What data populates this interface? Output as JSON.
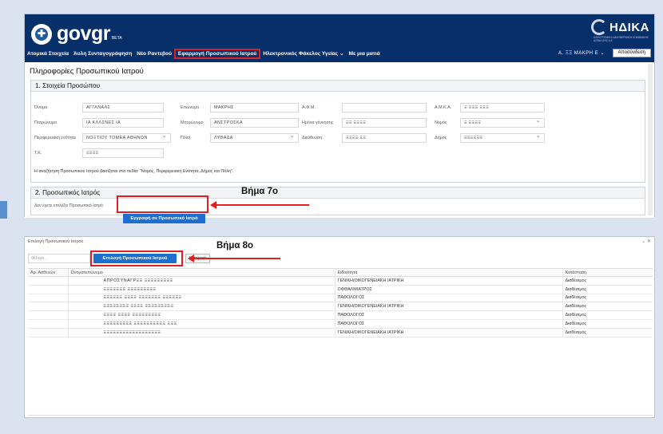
{
  "header": {
    "gov_logo_text": "gov",
    "gov_logo_suffix": "gr",
    "gov_beta": "BETA",
    "idika_text": "ΗΔΙΚΑ",
    "idika_sub": "ΗΛΕΚΤΡΟΝΙΚΗ ΔΙΑΚΥΒΕΡΝΗΣΗ ΚΟΙΝΩΝΙΚΗΣ ΑΣΦΑΛΙΣΗΣ Α.Ε."
  },
  "nav": {
    "items": [
      "Ατομικά Στοιχεία",
      "Άυλη Συνταγογράφηση",
      "Νέο Ραντεβού",
      "Εφαρμογή Προσωπικού Ιατρού",
      "Ηλεκτρονικός Φάκελος Υγείας ⌄",
      "Με μια ματιά"
    ],
    "user": "Α. ΞΞ ΜΑΚΡΗ Ε ⌄",
    "logout": "Αποσύνδεση"
  },
  "page": {
    "title": "Πληροφορίες Προσωπικού Ιατρού",
    "section1_title": "1. Στοιχεία Προσώπου",
    "section2_title": "2. Προσωπικός Ιατρός",
    "fields": {
      "onoma_label": "Όνομα",
      "onoma_value": "ΑΓΓΛΝΑΛΣ",
      "eponymo_label": "Επώνυμο",
      "eponymo_value": "ΜΑΚΡΗΣ",
      "afm_label": "Α.Φ.Μ.",
      "afm_value": "",
      "amka_label": "Α.Μ.Κ.Α.",
      "amka_value": "Ξ ΞΞΞ ΞΞΞ",
      "patronymo_label": "Πατρώνυμο",
      "patronymo_value": "ΙΑ ΚΛΛΣΝΕΣ ΙΑ",
      "mitronymo_label": "Μητρώνυμο",
      "mitronymo_value": "ΑΝΣΤΡΟΣΚΑ",
      "dob_label": "Ημ/νια γέννησης",
      "dob_value": "ΞΞ ΞΞΞΞ",
      "nomos_label": "Νομός",
      "nomos_value": "Ξ ΞΞΞΞ",
      "perif_label": "Περιφερειακή ενότητα",
      "perif_value": "ΝΟΞΤΙΟΥ ΤΟΜΕΑ ΑΘΗΝΩΝ",
      "poli_label": "Πόλη",
      "poli_value": "ΛΥΘΑΔΑ",
      "dieuthinsi_label": "Διεύθυνση",
      "dieuthinsi_value": "ΞΞΞΞ ΞΞ",
      "dimos_label": "Δήμος",
      "dimos_value": "ΞΞΞΞΞΞ",
      "tk_label": "Τ.Κ.",
      "tk_value": "ΞΞΞΞ"
    },
    "info_note": "Η αναζήτηση Προσωπικού Ιατρού βασίζεται στα πεδία: \"Νομός, Περιφερειακή Ενότητα, Δήμος και Πόλη\".",
    "no_doctor_text": "Δεν έχετε επιλέξει Προσωπικό Ιατρό",
    "register_button": "Εγγραφή σε Προσωπικό Ιατρό",
    "step7": "Βήμα 7ο"
  },
  "dialog": {
    "title": "Επιλογή Προσωπικού Ιατρού",
    "controls": "⌄  ✕",
    "filter_placeholder": "Φίλτρο...",
    "select_button": "Επιλογή Προσωπικού Ιατρού",
    "history_button": "Ιστορικό",
    "step8": "Βήμα 8ο",
    "columns": [
      "Αρ. Ασθενών",
      "Ονοματεπώνυμο",
      "Ειδικότητα",
      "Κατάσταση"
    ],
    "rows": [
      {
        "count": "",
        "name": "ΑΠΡΟΣΥΝΑΓΡΞΞ ΞΞΞΞΞΞΞΞΞ",
        "spec": "ΓΕΝΙΚΗ/ΟΙΚΟΓΕΝΕΙΑΚΗ ΙΑΤΡΙΚΗ",
        "status": "Διαθέσιμος"
      },
      {
        "count": "",
        "name": "ΞΞΞΞΞΞΞ ΞΞΞΞΞΞΞΞΞ",
        "spec": "ΟΦΘΑΛΜΙΑΤΡΟΣ",
        "status": "Διαθέσιμος"
      },
      {
        "count": "",
        "name": "ΞΞΞΞΞΞ ΞΞΞΞ ΞΞΞΞΞΞΞ ΞΞΞΞΞΞ",
        "spec": "ΠΑΘΟΛΟΓΟΣ",
        "status": "Διαθέσιμος"
      },
      {
        "count": "",
        "name": "ΞΞΞΞΞΞΞΞ ΞΞΞΞ ΞΞΞΞΞΞΞΞΞ",
        "spec": "ΓΕΝΙΚΗ/ΟΙΚΟΓΕΝΕΙΑΚΗ ΙΑΤΡΙΚΗ",
        "status": "Διαθέσιμος"
      },
      {
        "count": "",
        "name": "ΞΞΞΞ ΞΞΞΞ ΞΞΞΞΞΞΞΞΞ",
        "spec": "ΠΑΘΟΛΟΓΟΣ",
        "status": "Διαθέσιμος"
      },
      {
        "count": "",
        "name": "ΞΞΞΞΞΞΞΞΞ ΞΞΞΞΞΞΞΞΞΞ ΞΞΞ",
        "spec": "ΠΑΘΟΛΟΓΟΣ",
        "status": "Διαθέσιμος"
      },
      {
        "count": "",
        "name": "ΞΞΞΞΞΞΞΞΞΞΞΞΞΞΞΞΞΞ",
        "spec": "ΓΕΝΙΚΗ/ΟΙΚΟΓΕΝΕΙΑΚΗ ΙΑΤΡΙΚΗ",
        "status": "Διαθέσιμος"
      }
    ]
  }
}
